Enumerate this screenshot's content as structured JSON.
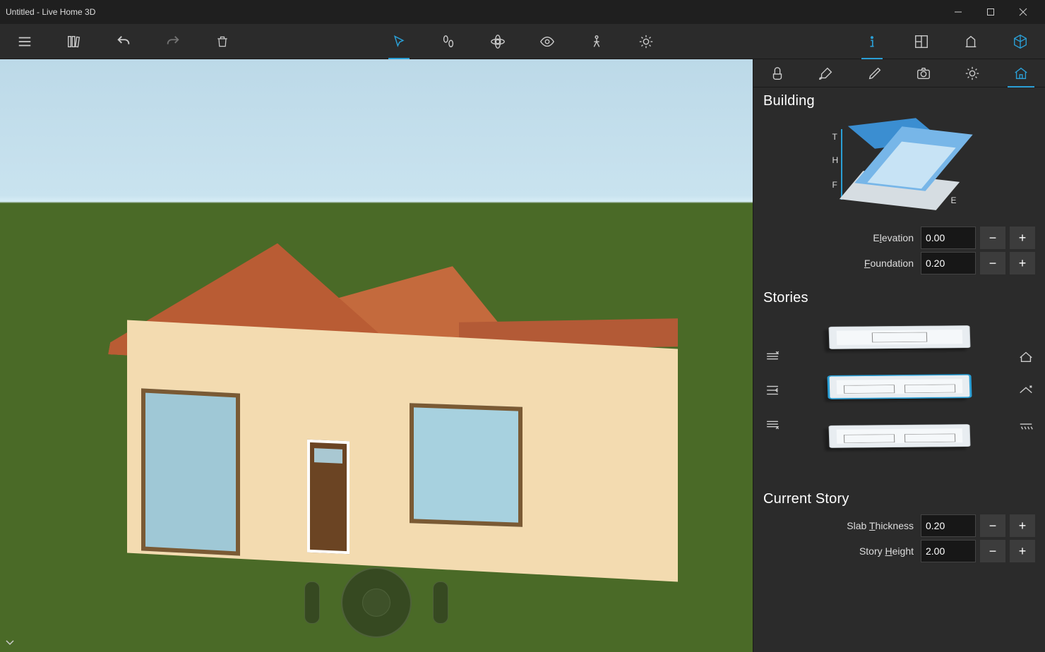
{
  "window": {
    "title": "Untitled - Live Home 3D"
  },
  "toolbar_left": {
    "menu": "menu-icon",
    "library": "books-icon",
    "undo": "undo-icon",
    "redo": "redo-icon",
    "delete": "trash-icon"
  },
  "toolbar_center": {
    "select": "cursor-icon",
    "walk": "footprints-icon",
    "orbit": "orbit-icon",
    "lookaround": "eye-icon",
    "measure": "figure-icon",
    "lighting": "sun-icon"
  },
  "toolbar_right": {
    "info": "info-icon",
    "view2d": "plan2d-icon",
    "elevation": "elevation-icon",
    "view3d": "cube-icon"
  },
  "panel_tabs": {
    "object": "hand-icon",
    "materials": "brush-icon",
    "edit": "pencil-icon",
    "camera": "camera-icon",
    "light": "sun-icon",
    "building": "house-icon"
  },
  "building": {
    "heading": "Building",
    "diagram_labels": {
      "T": "T",
      "H": "H",
      "F": "F",
      "E": "E"
    },
    "elevation": {
      "label_pre": "E",
      "label_u": "l",
      "label_post": "evation",
      "value": "0.00"
    },
    "foundation": {
      "label_pre": "",
      "label_u": "F",
      "label_post": "oundation",
      "value": "0.20"
    }
  },
  "stories": {
    "heading": "Stories",
    "left_icons": [
      "add-story-above-icon",
      "split-story-icon",
      "add-story-below-icon"
    ],
    "right_icons": [
      "roof-icon",
      "story-up-icon",
      "ground-icon"
    ]
  },
  "current_story": {
    "heading": "Current Story",
    "slab_thickness": {
      "label_pre": "Slab ",
      "label_u": "T",
      "label_post": "hickness",
      "value": "0.20"
    },
    "story_height": {
      "label_pre": "Story ",
      "label_u": "H",
      "label_post": "eight",
      "value": "2.00"
    }
  }
}
